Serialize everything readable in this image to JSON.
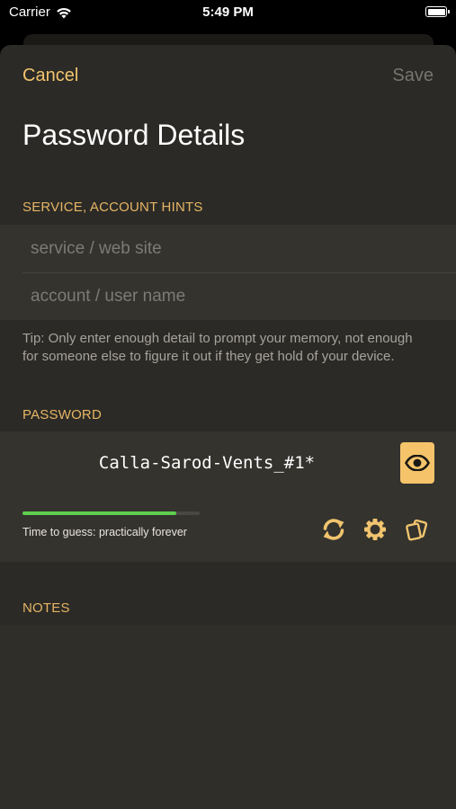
{
  "status_bar": {
    "carrier": "Carrier",
    "time": "5:49 PM"
  },
  "nav": {
    "cancel_label": "Cancel",
    "save_label": "Save"
  },
  "title": "Password Details",
  "hints_section": {
    "header": "SERVICE, ACCOUNT HINTS",
    "service_placeholder": "service / web site",
    "account_placeholder": "account / user name",
    "tip": "Tip: Only enter enough detail to prompt your memory, not enough for someone else to figure it out if they get hold of your device."
  },
  "password_section": {
    "header": "PASSWORD",
    "value": "Calla-Sarod-Vents_#1*",
    "strength_fraction": 0.87,
    "time_to_guess": "Time to guess: practically forever",
    "tools": [
      "refresh-icon",
      "gear-icon",
      "copy-icon"
    ],
    "reveal_icon": "eye-icon"
  },
  "notes_section": {
    "header": "NOTES"
  },
  "colors": {
    "accent": "#f1c46e",
    "sheet_bg": "#2b2a26",
    "field_bg": "#34332e",
    "strength_green": "#5fcf4d"
  }
}
